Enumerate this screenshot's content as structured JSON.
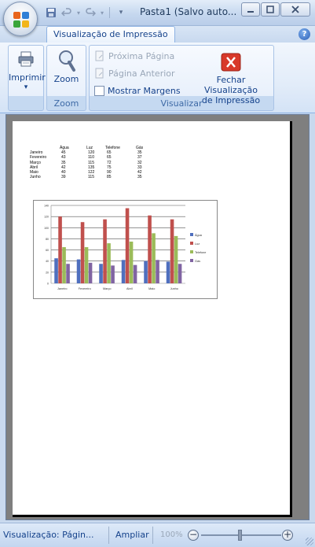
{
  "window": {
    "title": "Pasta1 (Salvo auto..."
  },
  "ribbon": {
    "tab_label": "Visualização de Impressão",
    "groups": {
      "print": {
        "button_label": "Imprimir",
        "dropdown_glyph": "▾"
      },
      "zoom": {
        "button_label": "Zoom",
        "group_label": "Zoom"
      },
      "view": {
        "next_page_label": "Próxima Página",
        "prev_page_label": "Página Anterior",
        "show_margins_label": "Mostrar Margens",
        "close_label_line1": "Fechar Visualização",
        "close_label_line2": "de Impressão",
        "group_label": "Visualizar"
      }
    }
  },
  "sheet_table": {
    "headers": [
      "Água",
      "Luz",
      "Telefone",
      "Gás"
    ],
    "rows": [
      {
        "month": "Janeiro",
        "values": [
          "45",
          "120",
          "65",
          "35"
        ]
      },
      {
        "month": "Fevereiro",
        "values": [
          "43",
          "110",
          "65",
          "37"
        ]
      },
      {
        "month": "Março",
        "values": [
          "35",
          "115",
          "72",
          "32"
        ]
      },
      {
        "month": "Abril",
        "values": [
          "42",
          "135",
          "75",
          "33"
        ]
      },
      {
        "month": "Maio",
        "values": [
          "40",
          "122",
          "90",
          "42"
        ]
      },
      {
        "month": "Junho",
        "values": [
          "39",
          "115",
          "85",
          "35"
        ]
      }
    ]
  },
  "chart_data": {
    "type": "bar",
    "categories": [
      "Janeiro",
      "Fevereiro",
      "Março",
      "Abril",
      "Maio",
      "Junho"
    ],
    "series": [
      {
        "name": "Água",
        "values": [
          45,
          43,
          35,
          42,
          40,
          39
        ],
        "color": "#4f6fbe"
      },
      {
        "name": "Luz",
        "values": [
          120,
          110,
          115,
          135,
          122,
          115
        ],
        "color": "#c0504d"
      },
      {
        "name": "Telefone",
        "values": [
          65,
          65,
          72,
          75,
          90,
          85
        ],
        "color": "#9bbb59"
      },
      {
        "name": "Gás",
        "values": [
          35,
          37,
          32,
          33,
          42,
          35
        ],
        "color": "#8064a2"
      }
    ],
    "ylim": [
      0,
      140
    ],
    "yticks": [
      0,
      20,
      40,
      60,
      80,
      100,
      120,
      140
    ],
    "grid": true,
    "legend": "right"
  },
  "statusbar": {
    "view_label": "Visualização: Págin...",
    "zoom_in_label": "Ampliar",
    "zoom_percent": "100%",
    "zoom_out_glyph": "−",
    "zoom_in_glyph": "+"
  },
  "icons": {
    "office_button": "office-logo-icon",
    "save": "save-icon",
    "undo": "undo-icon",
    "redo": "redo-icon",
    "print": "printer-icon",
    "zoom": "magnifier-icon",
    "close_preview": "close-red-icon",
    "help": "help-icon"
  }
}
